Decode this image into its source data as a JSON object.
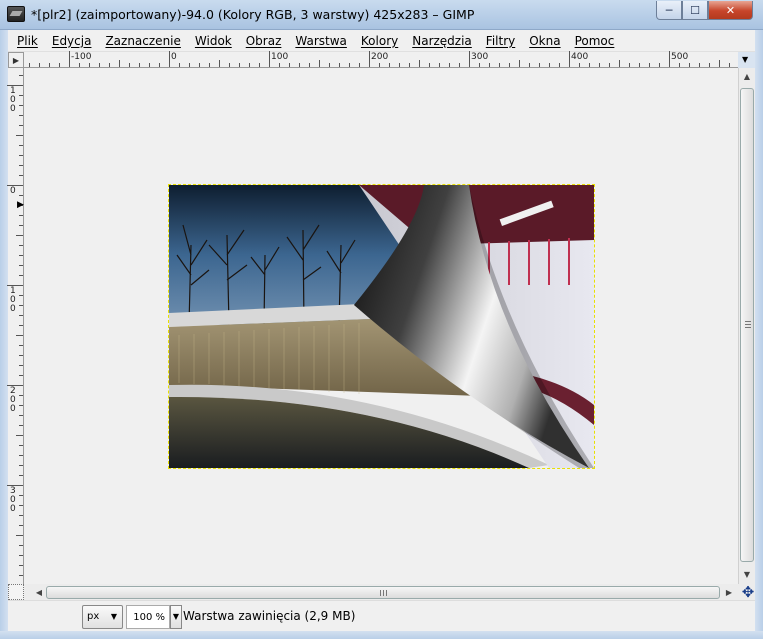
{
  "window": {
    "title": "*[plr2] (zaimportowany)-94.0 (Kolory RGB, 3 warstwy) 425x283 – GIMP",
    "min_label": "─",
    "max_label": "☐",
    "close_label": "✕"
  },
  "menu": [
    "Plik",
    "Edycja",
    "Zaznaczenie",
    "Widok",
    "Obraz",
    "Warstwa",
    "Kolory",
    "Narzędzia",
    "Filtry",
    "Okna",
    "Pomoc"
  ],
  "rulers": {
    "horizontal": [
      "-100",
      "0",
      "100",
      "200",
      "300",
      "400",
      "500"
    ],
    "vertical": [
      "100",
      "0",
      "100",
      "200",
      "300"
    ]
  },
  "statusbar": {
    "unit": "px",
    "zoom": "100 %",
    "layer_info": "Warstwa zawinięcia (2,9 MB)"
  },
  "colors": {
    "selection_border": "#e8e000",
    "canvas_bg": "#f0f0f0",
    "titlebar": "#b9cfe8"
  }
}
